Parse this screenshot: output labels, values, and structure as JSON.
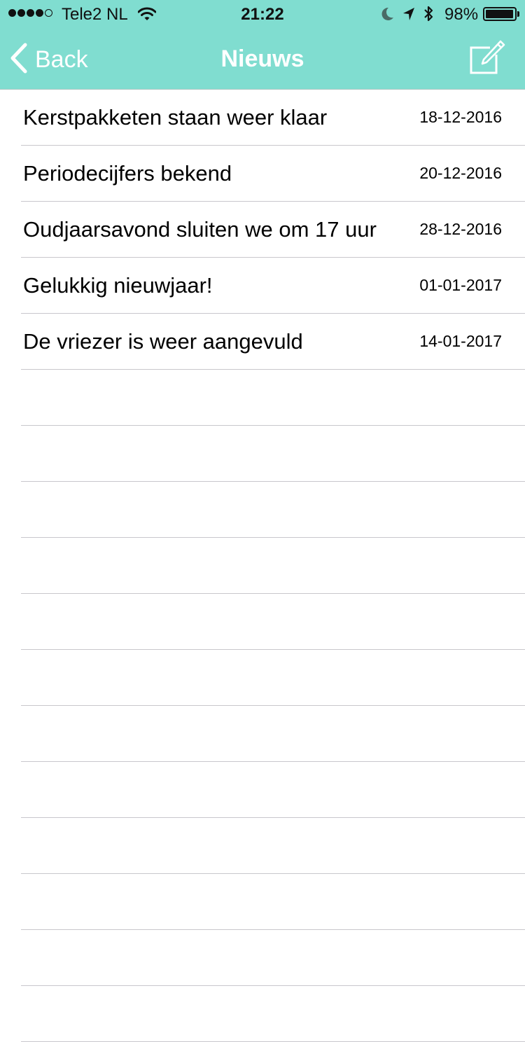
{
  "status_bar": {
    "carrier": "Tele2 NL",
    "time": "21:22",
    "battery": "98%",
    "battery_level": 0.98,
    "signal_bars": 4
  },
  "nav": {
    "back_label": "Back",
    "title": "Nieuws",
    "compose_icon": "compose-icon"
  },
  "colors": {
    "nav_background": "#80ddd0",
    "nav_text": "#ffffff",
    "separator": "#c8c7cc"
  },
  "news": [
    {
      "title": "Kerstpakketen staan weer klaar",
      "date": "18-12-2016"
    },
    {
      "title": "Periodecijfers bekend",
      "date": "20-12-2016"
    },
    {
      "title": "Oudjaarsavond sluiten we om 17 uur",
      "date": "28-12-2016"
    },
    {
      "title": "Gelukkig nieuwjaar!",
      "date": "01-01-2017"
    },
    {
      "title": "De vriezer is weer aangevuld",
      "date": "14-01-2017"
    }
  ]
}
